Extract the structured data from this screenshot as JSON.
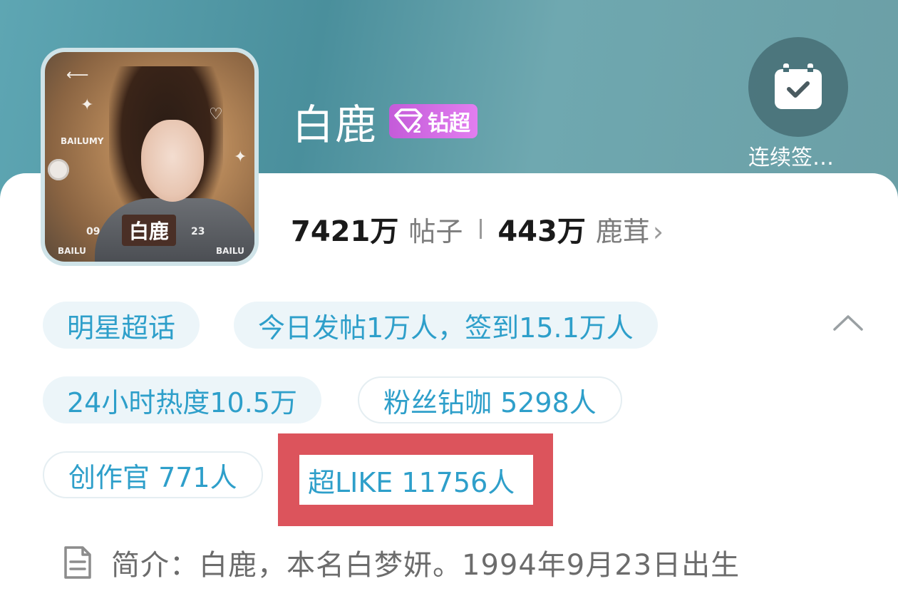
{
  "topic": {
    "name": "白鹿",
    "badge_label": "钻超",
    "badge_level": "2"
  },
  "avatar": {
    "caption": "白鹿",
    "date_left": "09",
    "date_right": "23",
    "brand_left": "BAILU",
    "brand_right": "BAILU",
    "tag_small": "BAILUMY"
  },
  "checkin": {
    "label": "连续签…"
  },
  "stats": {
    "posts_count": "7421万",
    "posts_label": "帖子",
    "fans_count": "443万",
    "fans_label": "鹿茸",
    "arrow": "›"
  },
  "chips": {
    "category": "明星超话",
    "today": "今日发帖1万人，签到15.1万人",
    "heat": "24小时热度10.5万",
    "diamond_fans": "粉丝钻咖 5298人",
    "creators": "创作官 771人",
    "super_like": "超LIKE 11756人"
  },
  "intro": {
    "text": "简介：白鹿，本名白梦妍。1994年9月23日出生"
  },
  "colors": {
    "accent": "#2e9fca",
    "highlight": "#dc545c",
    "badge": "#d06be3"
  }
}
